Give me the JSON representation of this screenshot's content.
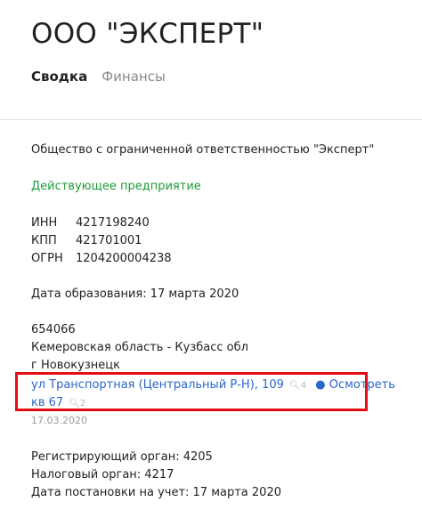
{
  "company": {
    "title": "ООО \"ЭКСПЕРТ\""
  },
  "tabs": {
    "summary": "Сводка",
    "finance": "Финансы"
  },
  "summary": {
    "full_name": "Общество с ограниченной ответственностью \"Эксперт\"",
    "status": "Действующее предприятие",
    "ids": [
      {
        "label": "ИНН",
        "value": "4217198240"
      },
      {
        "label": "КПП",
        "value": "421701001"
      },
      {
        "label": "ОГРН",
        "value": "1204200004238"
      }
    ],
    "founded": "Дата образования: 17 марта 2020",
    "address": {
      "postcode": "654066",
      "region": "Кемеровская область - Кузбасс обл",
      "city": "г Новокузнецк",
      "street": "ул Транспортная (Центральный Р-Н), 109",
      "street_count": "4",
      "view_link": "Осмотреть",
      "apartment": "кв 67",
      "apartment_count": "2",
      "date": "17.03.2020"
    },
    "registering_authority": "Регистрирующий орган: 4205",
    "tax_authority": "Налоговый орган: 4217",
    "registration_date": "Дата постановки на учет: 17 марта 2020"
  },
  "colors": {
    "link": "#2a67c9",
    "status": "#1f9a3a",
    "highlight": "#e20e17"
  }
}
